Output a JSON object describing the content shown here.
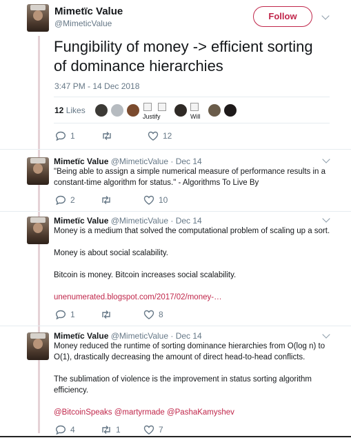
{
  "main_tweet": {
    "author_name": "Mimetïc Value",
    "author_handle": "@MimeticValue",
    "follow_label": "Follow",
    "text_line1": "Fungibility of money -> efficient sorting",
    "text_line2": "of dominance hierarchies",
    "timestamp": "3:47 PM - 14 Dec 2018",
    "likes_count": "12",
    "likes_label": "Likes",
    "liker_names": [
      "Justify",
      "Will"
    ],
    "reply_count": "1",
    "retweet_count": "",
    "like_count": "12"
  },
  "replies": [
    {
      "name": "Mimetïc Value",
      "meta": "@MimeticValue · Dec 14",
      "lines": [
        "\"Being able to assign a simple numerical measure of performance results in a",
        "constant-time algorithm for status.\" - Algorithms To Live By"
      ],
      "reply_count": "2",
      "retweet_count": "",
      "like_count": "10"
    },
    {
      "name": "Mimetïc Value",
      "meta": "@MimeticValue · Dec 14",
      "lines": [
        "Money is a medium that solved the computational problem of scaling up a sort.",
        "Money is about social scalability.",
        "Bitcoin is money. Bitcoin increases social scalability."
      ],
      "link": "unenumerated.blogspot.com/2017/02/money-…",
      "reply_count": "1",
      "retweet_count": "",
      "like_count": "8"
    },
    {
      "name": "Mimetïc Value",
      "meta": "@MimeticValue · Dec 14",
      "lines": [
        "Money reduced the runtime of sorting dominance hierarchies from O(log n) to",
        "O(1), drastically decreasing the amount of direct head-to-head conflicts.",
        "The sublimation of violence is the improvement in status sorting algorithm",
        "efficiency."
      ],
      "mentions": "@BitcoinSpeaks @martyrmade @PashaKamyshev",
      "reply_count": "4",
      "retweet_count": "1",
      "like_count": "7"
    }
  ],
  "colors": {
    "accent": "#c0264a",
    "muted": "#657786",
    "thread_line": "#e5d2d6"
  }
}
